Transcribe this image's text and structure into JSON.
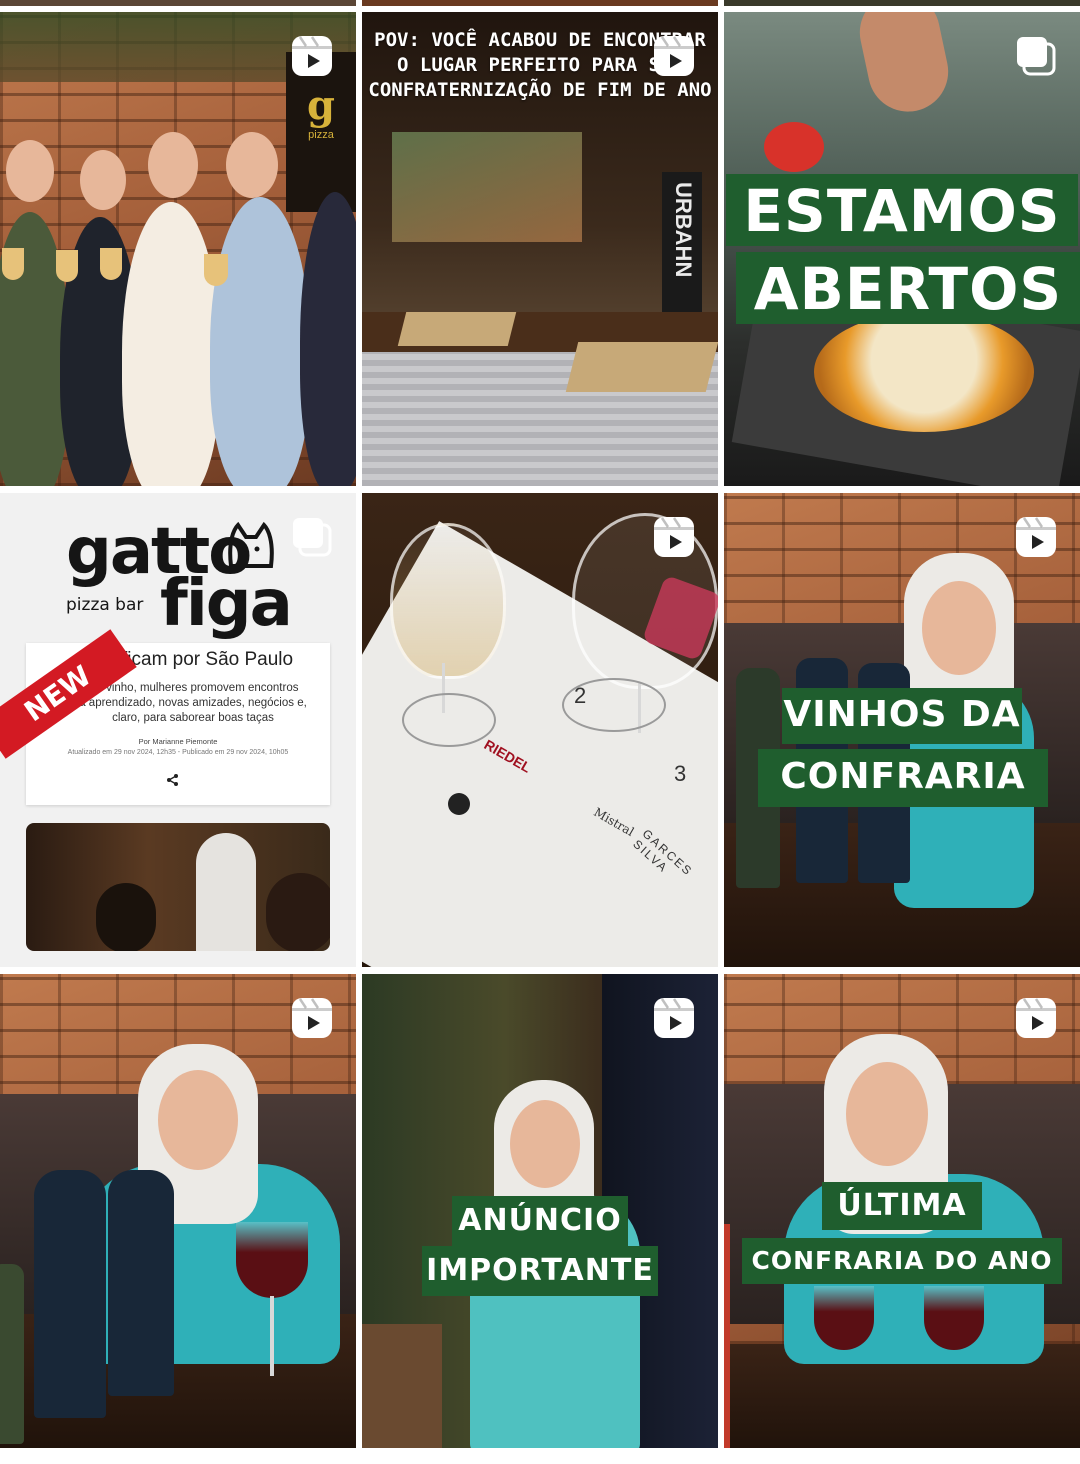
{
  "tiles": [
    {
      "name": "post-women-toast",
      "type": "reel",
      "badge_icon": "reels-icon",
      "logo": "gatto figa",
      "logo_sub": "pizza"
    },
    {
      "name": "post-pov-bar",
      "type": "reel",
      "badge_icon": "reels-icon",
      "caption_lines": [
        "POV: VOCÊ ACABOU DE ENCONTRAR",
        "O LUGAR PERFEITO PARA SUA",
        "CONFRATERNIZAÇÃO DE FIM DE ANO"
      ],
      "sign": "URBAHN"
    },
    {
      "name": "post-estamos-abertos",
      "type": "carousel",
      "badge_icon": "carousel-icon",
      "banner_lines": [
        "ESTAMOS",
        "ABERTOS"
      ]
    },
    {
      "name": "post-article",
      "type": "carousel",
      "badge_icon": "carousel-icon",
      "logo_main": "gatto",
      "logo_figa": "figa",
      "logo_sub": "pizza bar",
      "ribbon": "NEW",
      "headline": "ficam por São Paulo",
      "body_lines": [
        "elo vinho, mulheres promovem encontros",
        "a aprendizado, novas amizades, negócios e,",
        "claro, para saborear boas taças"
      ],
      "byline": "Por Marianne Piemonte",
      "dates": "Atualizado em 29 nov 2024, 12h35 - Publicado em 29 nov 2024, 10h05"
    },
    {
      "name": "post-wine-glasses",
      "type": "reel",
      "badge_icon": "reels-icon",
      "mat_numbers": [
        "2",
        "3"
      ],
      "mat_text": [
        "RIEDEL",
        "Mistral",
        "GARCES SILVA"
      ]
    },
    {
      "name": "post-vinhos-confraria",
      "type": "reel",
      "badge_icon": "reels-icon",
      "banner_lines": [
        "VINHOS DA",
        "CONFRARIA"
      ]
    },
    {
      "name": "post-bottles",
      "type": "reel",
      "badge_icon": "reels-icon"
    },
    {
      "name": "post-anuncio",
      "type": "reel",
      "badge_icon": "reels-icon",
      "banner_lines": [
        "ANÚNCIO",
        "IMPORTANTE"
      ]
    },
    {
      "name": "post-ultima-confraria",
      "type": "reel",
      "badge_icon": "reels-icon",
      "banner_lines": [
        "ÚLTIMA",
        "CONFRARIA DO ANO"
      ]
    }
  ],
  "colors": {
    "banner_green": "#1f5e2e",
    "ribbon_red": "#d31a23"
  }
}
